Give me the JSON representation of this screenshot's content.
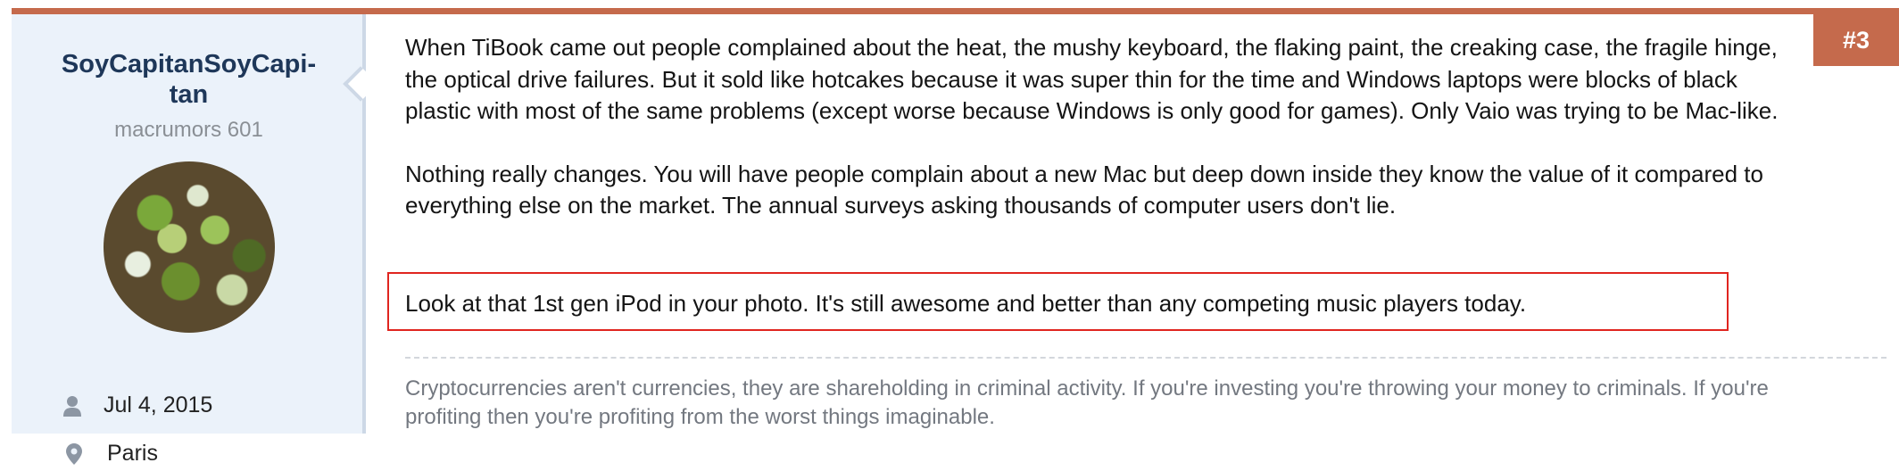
{
  "post": {
    "number": "#3",
    "author": {
      "username": "SoyCapitanSoyCapi-\ntan",
      "title": "macrumors 601",
      "avatar_icon": "avatar-photo",
      "joined_icon": "user-icon",
      "joined": "Jul 4, 2015",
      "location_icon": "map-pin-icon",
      "location": "Paris"
    },
    "paragraphs": [
      "When TiBook came out people complained about the heat, the mushy keyboard, the flaking paint, the creaking case, the fragile hinge, the optical drive failures. But it sold like hotcakes because it was super thin for the time and Windows laptops were blocks of black plastic with most of the same problems (except worse because Windows is only good for games). Only Vaio was trying to be Mac-like.",
      "Nothing really changes. You will have people complain about a new Mac but deep down inside they know the value of it compared to everything else on the market. The annual surveys asking thousands of computer users don't lie."
    ],
    "highlighted_text": "Look at that 1st gen iPod in your photo. It's still awesome and better than any competing music players today.",
    "signature": "Cryptocurrencies aren't currencies, they are shareholding in criminal activity. If you're investing you're throwing your money to criminals. If you're profiting then you're profiting from the worst things imaginable."
  },
  "colors": {
    "accent": "#c56a4c",
    "sidebar_bg": "#ebf2fa",
    "username": "#1e3759",
    "highlight_border": "#e0251f"
  }
}
